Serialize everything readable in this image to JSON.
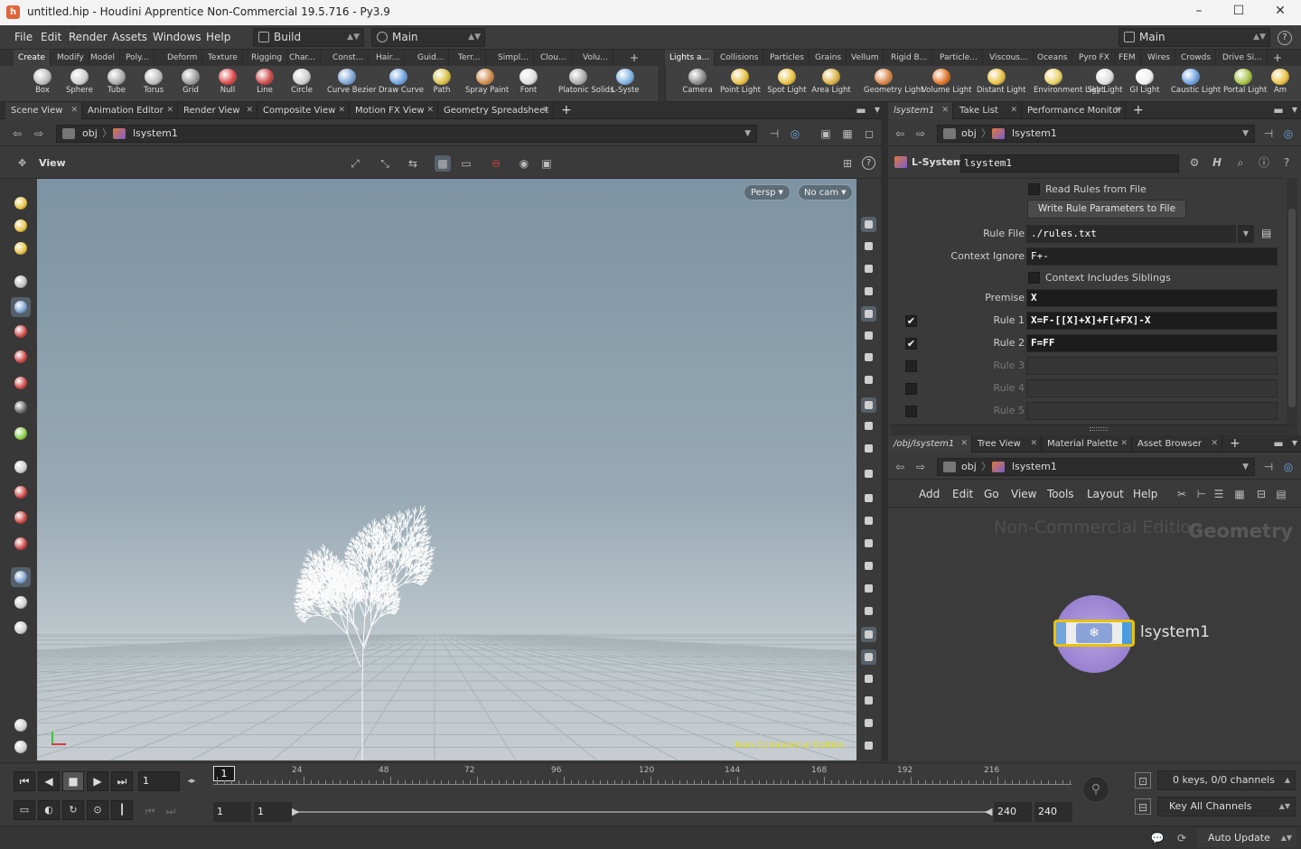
{
  "window": {
    "title": "untitled.hip - Houdini Apprentice Non-Commercial 19.5.716 - Py3.9"
  },
  "menu": {
    "items": [
      "File",
      "Edit",
      "Render",
      "Assets",
      "Windows",
      "Help"
    ],
    "desktop": "Build",
    "ui_set": "Main",
    "right_desktop": "Main"
  },
  "shelf": {
    "left_tabs": [
      "Create",
      "Modify",
      "Model",
      "Poly...",
      "Deform",
      "Texture",
      "Rigging",
      "Char...",
      "Const...",
      "Hair...",
      "Guid...",
      "Terr...",
      "Simpl...",
      "Clou...",
      "Volu..."
    ],
    "left_tools": [
      "Box",
      "Sphere",
      "Tube",
      "Torus",
      "Grid",
      "Null",
      "Line",
      "Circle",
      "Curve Bezier",
      "Draw Curve",
      "Path",
      "Spray Paint",
      "Font",
      "Platonic Solids",
      "L-Syste"
    ],
    "right_tabs": [
      "Lights a...",
      "Collisions",
      "Particles",
      "Grains",
      "Vellum",
      "Rigid B...",
      "Particle...",
      "Viscous...",
      "Oceans",
      "Pyro FX",
      "FEM",
      "Wires",
      "Crowds",
      "Drive Si..."
    ],
    "right_tools": [
      "Camera",
      "Point Light",
      "Spot Light",
      "Area Light",
      "Geometry Light",
      "Volume Light",
      "Distant Light",
      "Environment Light",
      "Sky Light",
      "GI Light",
      "Caustic Light",
      "Portal Light",
      "Am"
    ]
  },
  "left_pane": {
    "tabs": [
      "Scene View",
      "Animation Editor",
      "Render View",
      "Composite View",
      "Motion FX View",
      "Geometry Spreadsheet"
    ],
    "path": {
      "root": "obj",
      "node": "lsystem1"
    },
    "view_label": "View",
    "camera_menu": "Persp",
    "cam_menu": "No cam",
    "watermark": "Non-Commercial Edition"
  },
  "parm_pane": {
    "tabs": [
      "lsystem1",
      "Take List",
      "Performance Monitor"
    ],
    "path": {
      "root": "obj",
      "node": "lsystem1"
    },
    "node_type": "L-System",
    "node_name": "lsystem1",
    "read_rules_label": "Read Rules from File",
    "write_button": "Write Rule Parameters to File",
    "rule_file_label": "Rule File",
    "rule_file_value": "./rules.txt",
    "context_ignore_label": "Context Ignore",
    "context_ignore_value": "F+-",
    "context_siblings_label": "Context Includes Siblings",
    "premise_label": "Premise",
    "premise_value": "X",
    "rules": [
      {
        "label": "Rule 1",
        "value": "X=F-[[X]+X]+F[+FX]-X",
        "checked": true
      },
      {
        "label": "Rule 2",
        "value": "F=FF",
        "checked": true
      },
      {
        "label": "Rule 3",
        "value": "",
        "checked": false
      },
      {
        "label": "Rule 4",
        "value": "",
        "checked": false
      },
      {
        "label": "Rule 5",
        "value": "",
        "checked": false
      }
    ]
  },
  "network_pane": {
    "tabs": [
      "/obj/lsystem1",
      "Tree View",
      "Material Palette",
      "Asset Browser"
    ],
    "path": {
      "root": "obj",
      "node": "lsystem1"
    },
    "menu": [
      "Add",
      "Edit",
      "Go",
      "View",
      "Tools",
      "Layout",
      "Help"
    ],
    "watermark": "Non-Commercial Edition",
    "context": "Geometry",
    "node_label": "lsystem1"
  },
  "timeline": {
    "current_frame": "1",
    "frame_marker": "1",
    "ticks": [
      "24",
      "48",
      "72",
      "96",
      "120",
      "144",
      "168",
      "192",
      "216"
    ],
    "range_start": "1",
    "range_start2": "1",
    "range_end": "240",
    "range_end2": "240",
    "keys_status": "0 keys, 0/0 channels",
    "key_all": "Key All Channels"
  },
  "status": {
    "update_mode": "Auto Update"
  },
  "colors": {
    "accent": "#e8c200",
    "node_blue": "#5a8ad0",
    "node_purple": "#8f73c9"
  }
}
